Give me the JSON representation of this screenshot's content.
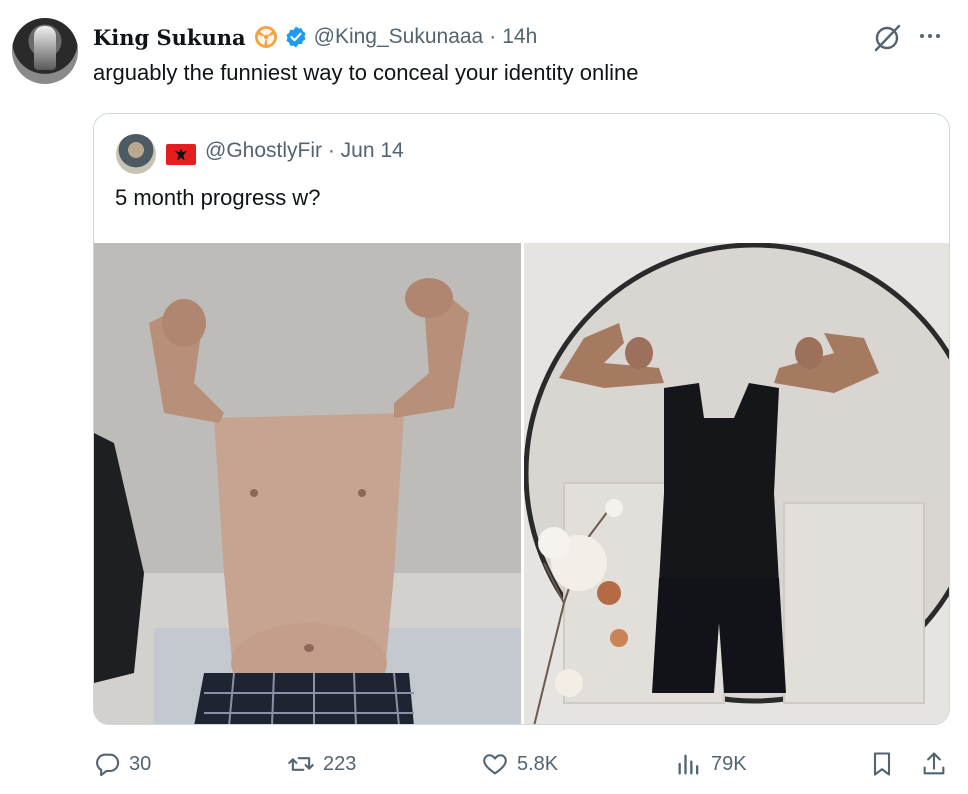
{
  "tweet": {
    "display_name": "King Sukuna",
    "handle": "@King_Sukunaaa",
    "time": "14h",
    "text": "arguably the funniest way to conceal your identity online"
  },
  "quoted_tweet": {
    "handle": "@GhostlyFir",
    "date": "Jun 14",
    "text": "5 month progress w?"
  },
  "actions": {
    "replies": "30",
    "retweets": "223",
    "likes": "5.8K",
    "views": "79K"
  },
  "colors": {
    "text_primary": "#0f1419",
    "text_secondary": "#536471",
    "verified": "#1d9bf0",
    "affiliate_badge": "#f4a340",
    "border": "#cfd9de"
  },
  "icons": [
    "avatar",
    "affiliate-badge-icon",
    "verified-badge-icon",
    "grok-icon",
    "more-icon",
    "reply-icon",
    "retweet-icon",
    "like-icon",
    "views-icon",
    "bookmark-icon",
    "share-icon"
  ]
}
